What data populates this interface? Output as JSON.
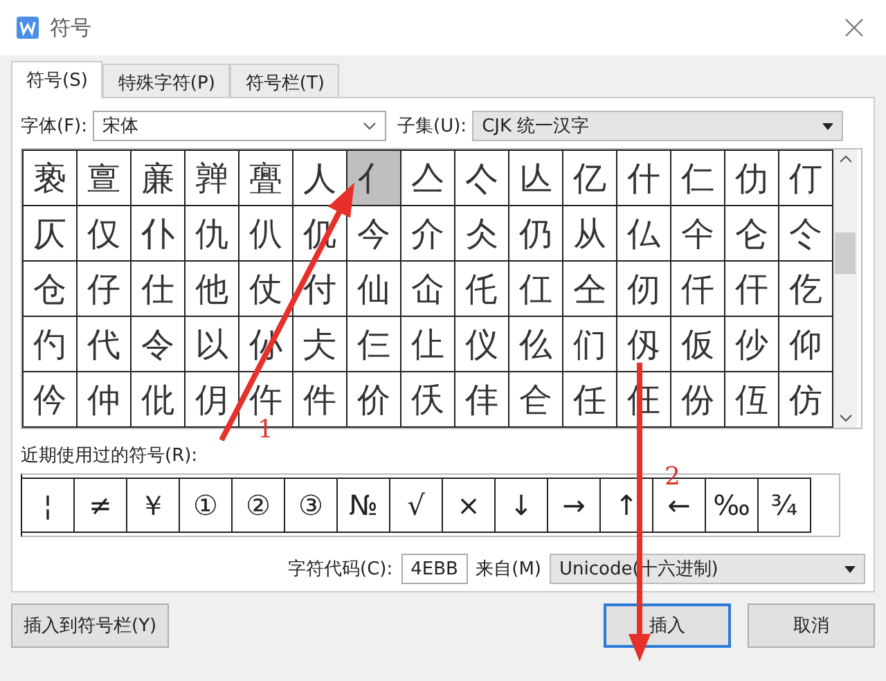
{
  "window": {
    "title": "符号"
  },
  "tabs": [
    {
      "label": "符号(S)",
      "selected": true
    },
    {
      "label": "特殊字符(P)",
      "selected": false
    },
    {
      "label": "符号栏(T)",
      "selected": false
    }
  ],
  "font": {
    "label": "字体(F):",
    "value": "宋体"
  },
  "subset": {
    "label": "子集(U):",
    "value": "CJK 统一汉字"
  },
  "grid": {
    "rows": [
      [
        {
          "char": "亵",
          "selected": false
        },
        {
          "char": "亶",
          "selected": false
        },
        {
          "char": "亷",
          "selected": false
        },
        {
          "char": "亸",
          "selected": false
        },
        {
          "char": "亹",
          "selected": false
        },
        {
          "char": "人",
          "selected": false
        },
        {
          "char": "亻",
          "selected": true
        },
        {
          "char": "亼",
          "selected": false
        },
        {
          "char": "亽",
          "selected": false
        },
        {
          "char": "亾",
          "selected": false
        },
        {
          "char": "亿",
          "selected": false
        },
        {
          "char": "什",
          "selected": false
        },
        {
          "char": "仁",
          "selected": false
        },
        {
          "char": "仂",
          "selected": false
        },
        {
          "char": "仃",
          "selected": false
        }
      ],
      [
        {
          "char": "仄",
          "selected": false
        },
        {
          "char": "仅",
          "selected": false
        },
        {
          "char": "仆",
          "selected": false
        },
        {
          "char": "仇",
          "selected": false
        },
        {
          "char": "仈",
          "selected": false
        },
        {
          "char": "仉",
          "selected": false
        },
        {
          "char": "今",
          "selected": false
        },
        {
          "char": "介",
          "selected": false
        },
        {
          "char": "仌",
          "selected": false
        },
        {
          "char": "仍",
          "selected": false
        },
        {
          "char": "从",
          "selected": false
        },
        {
          "char": "仏",
          "selected": false
        },
        {
          "char": "仐",
          "selected": false
        },
        {
          "char": "仑",
          "selected": false
        },
        {
          "char": "仒",
          "selected": false
        }
      ],
      [
        {
          "char": "仓",
          "selected": false
        },
        {
          "char": "仔",
          "selected": false
        },
        {
          "char": "仕",
          "selected": false
        },
        {
          "char": "他",
          "selected": false
        },
        {
          "char": "仗",
          "selected": false
        },
        {
          "char": "付",
          "selected": false
        },
        {
          "char": "仙",
          "selected": false
        },
        {
          "char": "仚",
          "selected": false
        },
        {
          "char": "仛",
          "selected": false
        },
        {
          "char": "仜",
          "selected": false
        },
        {
          "char": "仝",
          "selected": false
        },
        {
          "char": "仞",
          "selected": false
        },
        {
          "char": "仟",
          "selected": false
        },
        {
          "char": "仠",
          "selected": false
        },
        {
          "char": "仡",
          "selected": false
        }
      ],
      [
        {
          "char": "仢",
          "selected": false
        },
        {
          "char": "代",
          "selected": false
        },
        {
          "char": "令",
          "selected": false
        },
        {
          "char": "以",
          "selected": false
        },
        {
          "char": "仦",
          "selected": false
        },
        {
          "char": "仧",
          "selected": false
        },
        {
          "char": "仨",
          "selected": false
        },
        {
          "char": "仩",
          "selected": false
        },
        {
          "char": "仪",
          "selected": false
        },
        {
          "char": "仫",
          "selected": false
        },
        {
          "char": "们",
          "selected": false
        },
        {
          "char": "仭",
          "selected": false
        },
        {
          "char": "仮",
          "selected": false
        },
        {
          "char": "仯",
          "selected": false
        },
        {
          "char": "仰",
          "selected": false
        }
      ],
      [
        {
          "char": "仱",
          "selected": false
        },
        {
          "char": "仲",
          "selected": false
        },
        {
          "char": "仳",
          "selected": false
        },
        {
          "char": "仴",
          "selected": false
        },
        {
          "char": "仵",
          "selected": false
        },
        {
          "char": "件",
          "selected": false
        },
        {
          "char": "价",
          "selected": false
        },
        {
          "char": "仸",
          "selected": false
        },
        {
          "char": "仹",
          "selected": false
        },
        {
          "char": "仺",
          "selected": false
        },
        {
          "char": "任",
          "selected": false
        },
        {
          "char": "仼",
          "selected": false
        },
        {
          "char": "份",
          "selected": false
        },
        {
          "char": "仾",
          "selected": false
        },
        {
          "char": "仿",
          "selected": false
        }
      ]
    ]
  },
  "recent": {
    "label": "近期使用过的符号(R):",
    "symbols": [
      "¦",
      "≠",
      "￥",
      "①",
      "②",
      "③",
      "№",
      "√",
      "×",
      "↓",
      "→",
      "↑",
      "←",
      "‰",
      "¾"
    ]
  },
  "code": {
    "label": "字符代码(C):",
    "value": "4EBB"
  },
  "from": {
    "label": "来自(M)",
    "value": "Unicode(十六进制)"
  },
  "buttons": [
    {
      "kind": "left",
      "label": "插入到符号栏(Y)",
      "default": false
    },
    {
      "kind": "right",
      "label": "插入",
      "default": true
    },
    {
      "kind": "right",
      "label": "取消",
      "default": false
    }
  ],
  "annotations": [
    {
      "label": "1"
    },
    {
      "label": "2"
    }
  ]
}
